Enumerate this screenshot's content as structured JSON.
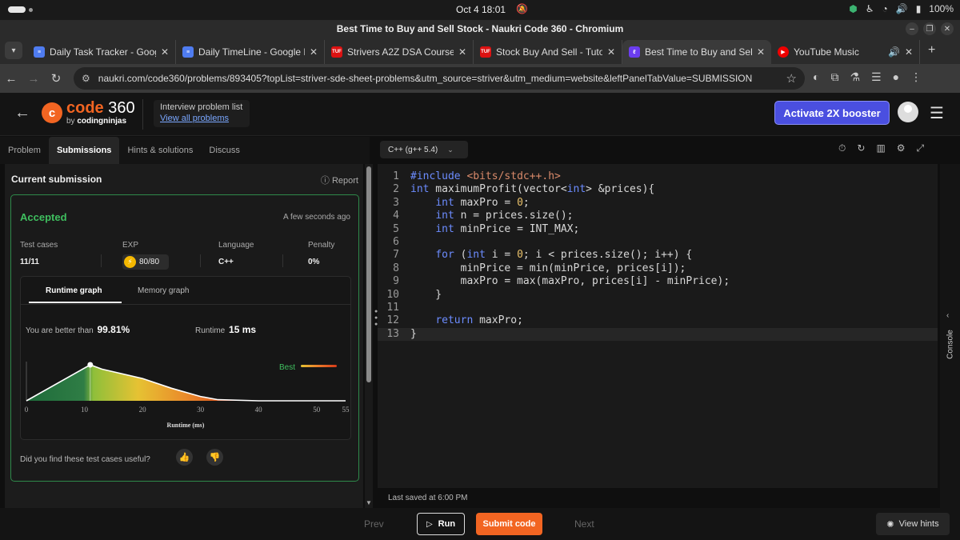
{
  "os": {
    "clock": "Oct 4  18:01",
    "battery": "100%"
  },
  "browser": {
    "window_title": "Best Time to Buy and Sell Stock - Naukri Code 360 - Chromium",
    "tabs": [
      {
        "label": "Daily Task Tracker - Goog",
        "favicon": "docs"
      },
      {
        "label": "Daily TimeLine - Google D",
        "favicon": "docs"
      },
      {
        "label": "Strivers A2Z DSA Course",
        "favicon": "tuf"
      },
      {
        "label": "Stock Buy And Sell - Tuto",
        "favicon": "tuf"
      },
      {
        "label": "Best Time to Buy and Sel",
        "favicon": "cn"
      },
      {
        "label": "YouTube Music",
        "favicon": "yt"
      }
    ],
    "url": "naukri.com/code360/problems/893405?topList=striver-sde-sheet-problems&utm_source=striver&utm_medium=website&leftPanelTabValue=SUBMISSION"
  },
  "header": {
    "logo_main": "code",
    "logo_num": "360",
    "logo_by": "by",
    "logo_sub": "codingninjas",
    "iplist_title": "Interview problem list",
    "iplist_link": "View all problems",
    "booster_label": "Activate 2X booster"
  },
  "panel_tabs": [
    "Problem",
    "Submissions",
    "Hints & solutions",
    "Discuss"
  ],
  "language": "C++ (g++ 5.4)",
  "submission": {
    "heading": "Current submission",
    "report_label": "Report",
    "status": "Accepted",
    "time": "A few seconds ago",
    "stats": {
      "test_cases_label": "Test cases",
      "test_cases_value": "11/11",
      "exp_label": "EXP",
      "exp_value": "80/80",
      "language_label": "Language",
      "language_value": "C++",
      "penalty_label": "Penalty",
      "penalty_value": "0%"
    },
    "graph_tabs": [
      "Runtime graph",
      "Memory graph"
    ],
    "better_label": "You are better than",
    "better_value": "99.81%",
    "runtime_label": "Runtime",
    "runtime_value": "15 ms",
    "feedback": "Did you find these test cases useful?"
  },
  "chart_data": {
    "type": "area",
    "xlabel": "Runtime (ms)",
    "ylabel": "",
    "x_ticks": [
      0,
      10,
      20,
      30,
      40,
      50,
      55
    ],
    "xlim": [
      0,
      55
    ],
    "legend": "Best",
    "marker_x": 11,
    "series": [
      {
        "x": [
          0,
          11,
          13,
          20,
          25,
          30,
          33,
          40,
          55
        ],
        "y": [
          0,
          1.0,
          0.88,
          0.62,
          0.35,
          0.12,
          0.03,
          0.0,
          0.0
        ]
      }
    ]
  },
  "editor": {
    "lines": [
      "#include <bits/stdc++.h>",
      "int maximumProfit(vector<int> &prices){",
      "    int maxPro = 0;",
      "    int n = prices.size();",
      "    int minPrice = INT_MAX;",
      "",
      "    for (int i = 0; i < prices.size(); i++) {",
      "        minPrice = min(minPrice, prices[i]);",
      "        maxPro = max(maxPro, prices[i] - minPrice);",
      "    }",
      "",
      "    return maxPro;",
      "}"
    ],
    "last_saved": "Last saved at 6:00 PM"
  },
  "console_label": "Console",
  "bottom": {
    "prev_label": "Prev",
    "run_label": "Run",
    "submit_label": "Submit code",
    "next_label": "Next",
    "hints_label": "View hints"
  },
  "colors": {
    "accent_orange": "#f26522",
    "accepted_green": "#3fbf5f",
    "booster_blue": "#4a4fe0"
  }
}
